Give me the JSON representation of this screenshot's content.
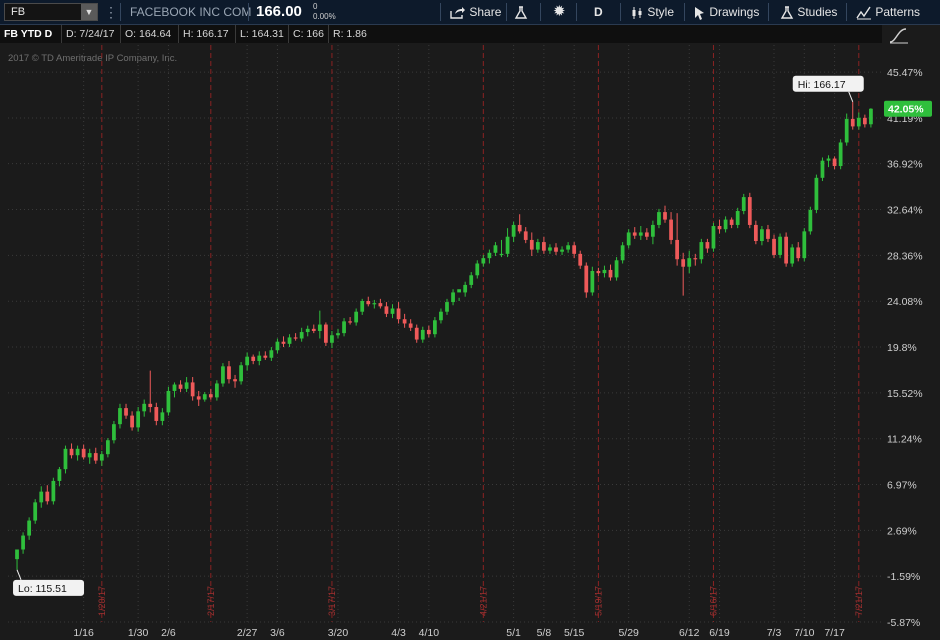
{
  "toolbar": {
    "symbol": "FB",
    "company_name": "FACEBOOK INC COM",
    "last_price": "166.00",
    "net_change": "0",
    "pct_change": "0.00%",
    "share_label": "Share",
    "timeframe_label": "D",
    "style_label": "Style",
    "drawings_label": "Drawings",
    "studies_label": "Studies",
    "patterns_label": "Patterns"
  },
  "info_bar": {
    "title": "FB YTD D",
    "date": "D: 7/24/17",
    "open": "O: 164.64",
    "high": "H: 166.17",
    "low": "L: 164.31",
    "close": "C: 166",
    "range": "R: 1.86"
  },
  "copyright": "2017 © TD Ameritrade IP Company, Inc.",
  "colors": {
    "up": "#2fbf3c",
    "down": "#ef5a5a",
    "event_line": "#8a2222",
    "grid": "#3a3a3a",
    "pct_badge": "#2fbf3c"
  },
  "chart_data": {
    "type": "candlestick",
    "title": "FB YTD D",
    "ylabel": "Percent change",
    "ylim": [
      -5.87,
      48.0
    ],
    "y_ticks": [
      "45.47%",
      "41.19%",
      "36.92%",
      "32.64%",
      "28.36%",
      "24.08%",
      "19.8%",
      "15.52%",
      "11.24%",
      "6.97%",
      "2.69%",
      "-1.59%",
      "-5.87%"
    ],
    "x_ticks": [
      {
        "label": "1/16",
        "day": 11
      },
      {
        "label": "1/30",
        "day": 20
      },
      {
        "label": "2/6",
        "day": 25
      },
      {
        "label": "2/27",
        "day": 38
      },
      {
        "label": "3/6",
        "day": 43
      },
      {
        "label": "3/20",
        "day": 53
      },
      {
        "label": "4/3",
        "day": 63
      },
      {
        "label": "4/10",
        "day": 68
      },
      {
        "label": "5/1",
        "day": 82
      },
      {
        "label": "5/8",
        "day": 87
      },
      {
        "label": "5/15",
        "day": 92
      },
      {
        "label": "5/29",
        "day": 101
      },
      {
        "label": "6/12",
        "day": 111
      },
      {
        "label": "6/19",
        "day": 116
      },
      {
        "label": "7/3",
        "day": 125
      },
      {
        "label": "7/10",
        "day": 130
      },
      {
        "label": "7/17",
        "day": 135
      }
    ],
    "event_markers": [
      {
        "label": "1/20/17",
        "day": 14
      },
      {
        "label": "2/17/17",
        "day": 32
      },
      {
        "label": "3/17/17",
        "day": 52
      },
      {
        "label": "4/21/17",
        "day": 77
      },
      {
        "label": "5/19/17",
        "day": 96
      },
      {
        "label": "6/16/17",
        "day": 115
      },
      {
        "label": "7/21/17",
        "day": 139
      }
    ],
    "high_label": "Hi: 166.17",
    "low_label": "Lo: 115.51",
    "current_pct": "42.05%",
    "candles": [
      [
        0.0,
        0.3,
        -1.0,
        0.9
      ],
      [
        0.9,
        2.5,
        0.5,
        2.2
      ],
      [
        2.2,
        3.9,
        1.8,
        3.6
      ],
      [
        3.6,
        5.6,
        3.3,
        5.3
      ],
      [
        5.3,
        6.8,
        4.8,
        6.3
      ],
      [
        6.3,
        6.9,
        5.1,
        5.4
      ],
      [
        5.4,
        7.6,
        5.1,
        7.3
      ],
      [
        7.3,
        8.6,
        6.8,
        8.4
      ],
      [
        8.4,
        10.6,
        8.0,
        10.3
      ],
      [
        10.3,
        10.8,
        9.4,
        9.7
      ],
      [
        9.7,
        10.6,
        9.2,
        10.3
      ],
      [
        10.3,
        10.7,
        9.3,
        9.5
      ],
      [
        9.5,
        10.3,
        8.9,
        9.9
      ],
      [
        9.9,
        10.4,
        8.9,
        9.2
      ],
      [
        9.2,
        10.1,
        8.7,
        9.8
      ],
      [
        9.8,
        11.3,
        9.5,
        11.1
      ],
      [
        11.1,
        12.9,
        10.8,
        12.6
      ],
      [
        12.6,
        14.5,
        12.2,
        14.1
      ],
      [
        14.1,
        14.5,
        13.1,
        13.4
      ],
      [
        13.4,
        13.8,
        12.0,
        12.3
      ],
      [
        12.3,
        14.2,
        11.9,
        13.8
      ],
      [
        13.8,
        14.9,
        13.3,
        14.5
      ],
      [
        14.5,
        17.6,
        13.7,
        14.2
      ],
      [
        14.2,
        14.6,
        12.5,
        12.9
      ],
      [
        12.9,
        14.1,
        12.5,
        13.7
      ],
      [
        13.7,
        16.1,
        13.4,
        15.7
      ],
      [
        15.7,
        16.5,
        15.1,
        16.3
      ],
      [
        16.3,
        16.7,
        15.6,
        15.9
      ],
      [
        15.9,
        17.0,
        15.6,
        16.5
      ],
      [
        16.5,
        17.0,
        14.8,
        15.2
      ],
      [
        15.2,
        15.7,
        14.3,
        14.9
      ],
      [
        14.9,
        15.6,
        14.7,
        15.4
      ],
      [
        15.4,
        15.9,
        14.9,
        15.1
      ],
      [
        15.1,
        16.7,
        14.8,
        16.4
      ],
      [
        16.4,
        18.3,
        16.1,
        18.0
      ],
      [
        18.0,
        18.5,
        16.4,
        16.8
      ],
      [
        16.8,
        17.2,
        16.0,
        16.6
      ],
      [
        16.6,
        18.4,
        16.3,
        18.1
      ],
      [
        18.1,
        19.3,
        17.6,
        18.9
      ],
      [
        18.9,
        19.1,
        18.2,
        18.5
      ],
      [
        18.5,
        19.4,
        18.1,
        19.0
      ],
      [
        19.0,
        19.4,
        18.6,
        18.8
      ],
      [
        18.8,
        19.8,
        18.5,
        19.5
      ],
      [
        19.5,
        20.6,
        19.2,
        20.3
      ],
      [
        20.3,
        20.8,
        19.8,
        20.1
      ],
      [
        20.1,
        21.0,
        19.8,
        20.7
      ],
      [
        20.7,
        21.1,
        20.4,
        20.6
      ],
      [
        20.6,
        21.6,
        20.3,
        21.2
      ],
      [
        21.2,
        21.8,
        20.8,
        21.5
      ],
      [
        21.5,
        21.9,
        21.1,
        21.3
      ],
      [
        21.3,
        23.2,
        20.6,
        21.9
      ],
      [
        21.9,
        22.1,
        19.9,
        20.2
      ],
      [
        20.2,
        21.3,
        19.7,
        20.9
      ],
      [
        20.9,
        21.5,
        20.6,
        21.1
      ],
      [
        21.1,
        22.5,
        20.8,
        22.2
      ],
      [
        22.2,
        22.6,
        21.9,
        22.1
      ],
      [
        22.1,
        23.4,
        21.8,
        23.1
      ],
      [
        23.1,
        24.3,
        22.8,
        24.1
      ],
      [
        24.1,
        24.5,
        23.6,
        23.8
      ],
      [
        23.8,
        24.2,
        23.4,
        23.9
      ],
      [
        23.9,
        24.3,
        23.4,
        23.6
      ],
      [
        23.6,
        24.0,
        22.6,
        22.9
      ],
      [
        22.9,
        23.8,
        22.5,
        23.4
      ],
      [
        23.4,
        24.0,
        22.0,
        22.4
      ],
      [
        22.4,
        22.9,
        21.6,
        22.0
      ],
      [
        22.0,
        22.4,
        21.3,
        21.6
      ],
      [
        21.6,
        21.9,
        20.2,
        20.5
      ],
      [
        20.5,
        21.7,
        20.2,
        21.4
      ],
      [
        21.4,
        21.8,
        20.7,
        21.0
      ],
      [
        21.0,
        22.6,
        20.7,
        22.3
      ],
      [
        22.3,
        23.4,
        22.0,
        23.1
      ],
      [
        23.1,
        24.3,
        22.8,
        24.0
      ],
      [
        24.0,
        25.2,
        23.7,
        24.9
      ],
      [
        24.9,
        24.4,
        24.1,
        25.2
      ],
      [
        24.9,
        25.9,
        24.5,
        25.6
      ],
      [
        25.6,
        26.8,
        25.3,
        26.5
      ],
      [
        26.5,
        27.9,
        26.2,
        27.6
      ],
      [
        27.6,
        28.4,
        27.3,
        28.1
      ],
      [
        28.1,
        28.9,
        27.6,
        28.6
      ],
      [
        28.6,
        29.6,
        28.3,
        29.3
      ],
      [
        28.4,
        29.8,
        28.2,
        28.5
      ],
      [
        28.5,
        30.9,
        28.2,
        30.1
      ],
      [
        30.1,
        31.5,
        29.6,
        31.2
      ],
      [
        31.2,
        32.2,
        30.4,
        30.6
      ],
      [
        30.6,
        31.0,
        29.5,
        29.8
      ],
      [
        29.8,
        30.5,
        28.3,
        28.9
      ],
      [
        28.9,
        29.9,
        28.6,
        29.6
      ],
      [
        29.6,
        30.1,
        28.5,
        28.8
      ],
      [
        28.8,
        29.4,
        28.5,
        29.1
      ],
      [
        29.1,
        29.5,
        28.4,
        28.7
      ],
      [
        28.7,
        29.2,
        28.4,
        28.9
      ],
      [
        28.9,
        29.6,
        28.6,
        29.3
      ],
      [
        29.3,
        29.6,
        28.1,
        28.5
      ],
      [
        28.5,
        28.8,
        27.1,
        27.4
      ],
      [
        27.4,
        27.7,
        24.4,
        24.9
      ],
      [
        24.9,
        27.3,
        24.6,
        26.9
      ],
      [
        26.9,
        27.2,
        26.4,
        26.7
      ],
      [
        26.7,
        27.4,
        26.3,
        27.0
      ],
      [
        27.0,
        27.5,
        26.0,
        26.3
      ],
      [
        26.3,
        28.2,
        26.0,
        27.9
      ],
      [
        27.9,
        29.6,
        27.6,
        29.3
      ],
      [
        29.3,
        30.8,
        29.0,
        30.5
      ],
      [
        30.5,
        31.0,
        29.9,
        30.2
      ],
      [
        30.2,
        31.1,
        29.8,
        30.5
      ],
      [
        30.5,
        30.9,
        29.8,
        30.1
      ],
      [
        30.1,
        31.6,
        29.4,
        31.2
      ],
      [
        31.2,
        32.7,
        30.9,
        32.4
      ],
      [
        32.4,
        33.0,
        31.4,
        31.7
      ],
      [
        31.7,
        32.4,
        29.4,
        29.8
      ],
      [
        29.8,
        32.3,
        27.4,
        28.0
      ],
      [
        28.0,
        28.6,
        24.6,
        27.3
      ],
      [
        27.3,
        28.8,
        26.7,
        28.1
      ],
      [
        28.1,
        28.5,
        27.4,
        28.0
      ],
      [
        28.0,
        29.9,
        27.6,
        29.6
      ],
      [
        29.6,
        29.9,
        28.6,
        29.0
      ],
      [
        29.0,
        31.4,
        28.7,
        31.1
      ],
      [
        31.1,
        31.7,
        30.4,
        30.8
      ],
      [
        30.8,
        32.0,
        30.5,
        31.7
      ],
      [
        31.7,
        31.9,
        30.9,
        31.2
      ],
      [
        31.2,
        32.8,
        30.9,
        32.5
      ],
      [
        32.5,
        34.1,
        32.2,
        33.8
      ],
      [
        33.8,
        34.2,
        30.9,
        31.2
      ],
      [
        31.2,
        31.6,
        29.4,
        29.7
      ],
      [
        29.7,
        31.1,
        29.3,
        30.8
      ],
      [
        30.8,
        31.2,
        29.6,
        29.9
      ],
      [
        29.9,
        30.3,
        28.1,
        28.4
      ],
      [
        28.4,
        30.4,
        28.1,
        30.1
      ],
      [
        30.1,
        30.5,
        27.3,
        27.6
      ],
      [
        27.6,
        29.4,
        27.3,
        29.1
      ],
      [
        29.1,
        29.6,
        27.8,
        28.1
      ],
      [
        28.1,
        30.9,
        27.8,
        30.6
      ],
      [
        30.6,
        32.9,
        30.3,
        32.6
      ],
      [
        32.6,
        35.9,
        32.3,
        35.6
      ],
      [
        35.6,
        37.5,
        35.3,
        37.2
      ],
      [
        37.2,
        37.7,
        36.6,
        37.4
      ],
      [
        37.4,
        37.6,
        36.4,
        36.7
      ],
      [
        36.7,
        39.2,
        36.4,
        38.9
      ],
      [
        38.9,
        41.6,
        38.6,
        41.1
      ],
      [
        41.1,
        42.7,
        40.1,
        40.4
      ],
      [
        40.4,
        41.7,
        40.1,
        41.2
      ],
      [
        41.2,
        41.5,
        40.3,
        40.6
      ],
      [
        40.6,
        42.1,
        40.3,
        42.05
      ]
    ]
  }
}
